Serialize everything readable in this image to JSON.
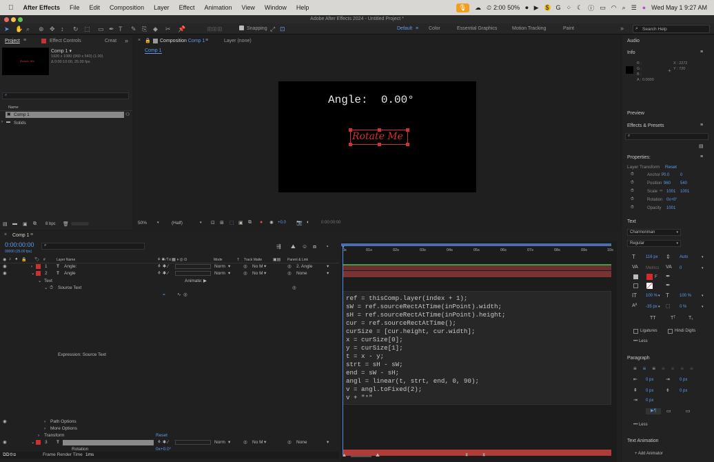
{
  "menubar": {
    "apple": "",
    "app": "After Effects",
    "menus": [
      "File",
      "Edit",
      "Composition",
      "Layer",
      "Effect",
      "Animation",
      "View",
      "Window",
      "Help"
    ],
    "battery": "2:00 50%",
    "clock": "Wed May 1  9:27 AM"
  },
  "window": {
    "title": "Adobe After Effects 2024 - Untitled Project *"
  },
  "toolbar": {
    "snapping": "Snapping",
    "workspaces": [
      "Default",
      "Color",
      "Essential Graphics",
      "Motion Tracking",
      "Paint"
    ],
    "search_placeholder": "Search Help"
  },
  "project": {
    "tabs": [
      "Project",
      "Effect Controls",
      "Creat"
    ],
    "comp_name": "Comp 1 ▾",
    "comp_info1": "1920 x 1080 (960 x 540) (1.00)",
    "comp_info2": "Δ 0:00:10:00, 25.00 fps",
    "thumb_text": "Rotate Me",
    "col_name": "Name",
    "items": [
      "Comp 1",
      "Solids"
    ],
    "bpc": "8 bpc"
  },
  "comp_viewer": {
    "tab_label": "Composition",
    "tab_name": "Comp 1",
    "layer_tab": "Layer (none)",
    "breadcrumb": "Comp 1",
    "angle_text": "Angle:  0.00°",
    "rotate_text": "Rotate Me",
    "zoom": "50%",
    "resolution": "(Half)",
    "exposure": "+0.0",
    "timecode": "0:00:00:00"
  },
  "timeline": {
    "tab": "Comp 1",
    "timecode": "0:00:00:00",
    "fps": "00000 (25.00 fps)",
    "col_layer": "Layer Name",
    "col_mode": "Mode",
    "col_t": "T",
    "col_track": "Track Matte",
    "col_parent": "Parent & Link",
    "layers": [
      {
        "num": "1",
        "name": "Angle:",
        "mode": "Norm",
        "matte": "No M",
        "parent": "2. Angle"
      },
      {
        "num": "2",
        "name": "Angle",
        "mode": "Norm",
        "matte": "No M",
        "parent": "None"
      }
    ],
    "layer3": {
      "num": "3",
      "mode": "Norm",
      "matte": "No M",
      "parent": "None"
    },
    "text_group": "Text",
    "animate": "Animate:",
    "source_text": "Source Text",
    "expression_label": "Expression: Source Text",
    "path_options": "Path Options",
    "more_options": "More Options",
    "transform": "Transform",
    "reset": "Reset",
    "rotation": "Rotation",
    "rotation_val": "0x+0.0°",
    "frame_render": "Frame Render Time",
    "frame_render_val": "1ms",
    "ruler": [
      "0s",
      "01s",
      "02s",
      "03s",
      "04s",
      "05s",
      "06s",
      "07s",
      "08s",
      "09s",
      "10s"
    ],
    "code": [
      "ref = thisComp.layer(index + 1);",
      "sW = ref.sourceRectAtTime(inPoint).width;",
      "sH = ref.sourceRectAtTime(inPoint).height;",
      "cur = ref.sourceRectAtTime();",
      "curSize = [cur.height, cur.width];",
      "x = curSize[0];",
      "y = curSize[1];",
      "t = x - y;",
      "strt = sH - sW;",
      "end = sW - sH;",
      "angl = linear(t, strt, end, 0, 90);",
      "v = angl.toFixed(2);",
      "v + \"°\""
    ]
  },
  "right": {
    "audio": "Audio",
    "info": "Info",
    "info_rgb": [
      "R :",
      "G :",
      "B :",
      "A :  0.0000"
    ],
    "info_xy": [
      "X : 2272",
      "Y : 720"
    ],
    "preview": "Preview",
    "effects": "Effects & Presets",
    "properties": "Properties:",
    "layer_transform": "Layer Transform",
    "reset": "Reset",
    "props": [
      {
        "label": "Anchor P",
        "v1": "0.0",
        "v2": "0"
      },
      {
        "label": "Position",
        "v1": "960",
        "v2": "540"
      },
      {
        "label": "Scale",
        "v1": "1001",
        "v2": "1001"
      },
      {
        "label": "Rotation",
        "v1": "0x+0°",
        "v2": ""
      },
      {
        "label": "Opacity",
        "v1": "1001",
        "v2": ""
      }
    ],
    "text": "Text",
    "font": "Charmonman",
    "style": "Regular",
    "size": "116 px",
    "leading": "Auto",
    "metrics": "Metrics",
    "tracking": "0",
    "fill_label": "F",
    "vscale": "100 %",
    "hscale": "100 %",
    "baseline": "-35 px",
    "tsume": "0 %",
    "caps": [
      "TT",
      "Tᵀ",
      "T₁"
    ],
    "ligatures": "Ligatures",
    "hindi": "Hindi Digits",
    "less": "Less",
    "paragraph": "Paragraph",
    "para_vals": [
      "0 px",
      "0 px",
      "0 px",
      "0 px",
      "0 px"
    ],
    "text_animation": "Text Animation",
    "add_animator": "Add Animator",
    "colors": {
      "red": "#d42a2a",
      "accent": "#4d8ef0"
    }
  }
}
